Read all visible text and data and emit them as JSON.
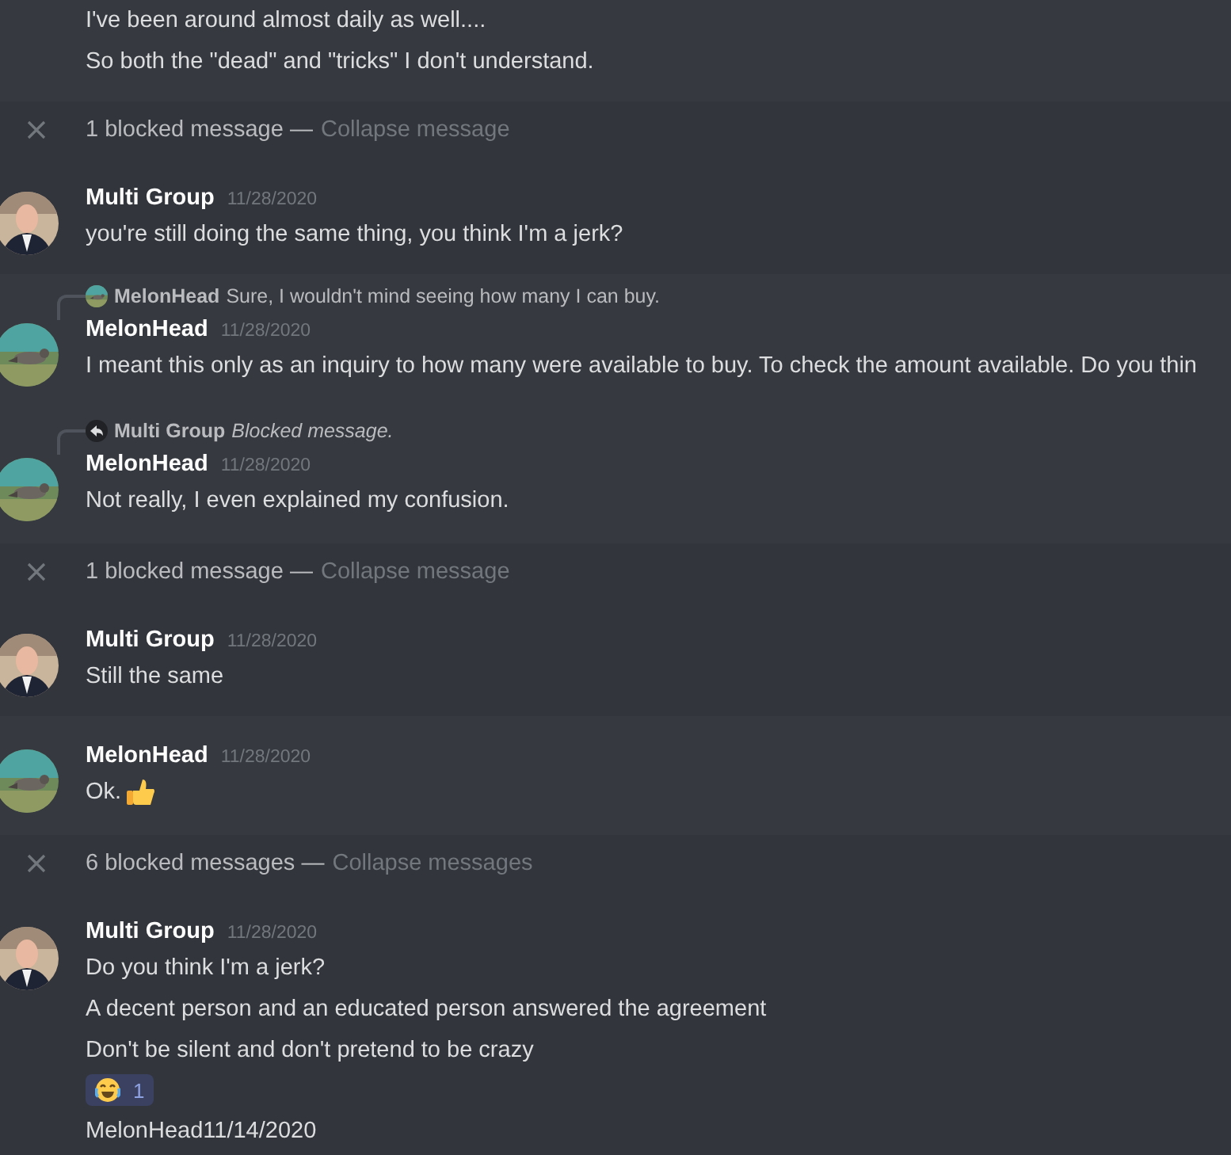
{
  "items": [
    {
      "kind": "continuation",
      "lines": [
        "I've been around almost daily as well....",
        "So both the \"dead\" and \"tricks\" I don't understand."
      ]
    },
    {
      "kind": "blocked",
      "summary": "1 blocked message —",
      "action": "Collapse message",
      "messages": [
        {
          "author": "Multi Group",
          "avatar": {
            "kind": "person"
          },
          "timestamp": "11/28/2020",
          "lines": [
            "you're still doing the same thing, you think I'm a jerk?"
          ]
        }
      ]
    },
    {
      "kind": "message",
      "author": "MelonHead",
      "avatar": {
        "kind": "bird"
      },
      "timestamp": "11/28/2020",
      "reply": {
        "author": "MelonHead",
        "avatar": {
          "kind": "bird"
        },
        "blocked": false,
        "text": "Sure, I wouldn't mind seeing how many I can buy."
      },
      "lines": [
        "I meant this only as an inquiry to how many were available to buy. To check the amount available. Do you thin"
      ]
    },
    {
      "kind": "message",
      "author": "MelonHead",
      "avatar": {
        "kind": "bird"
      },
      "timestamp": "11/28/2020",
      "reply": {
        "author": "Multi Group",
        "blocked": true,
        "text": "Blocked message."
      },
      "lines": [
        "Not really, I even explained my confusion."
      ]
    },
    {
      "kind": "blocked",
      "summary": "1 blocked message —",
      "action": "Collapse message",
      "messages": [
        {
          "author": "Multi Group",
          "avatar": {
            "kind": "person"
          },
          "timestamp": "11/28/2020",
          "lines": [
            "Still the same"
          ]
        }
      ]
    },
    {
      "kind": "message",
      "author": "MelonHead",
      "avatar": {
        "kind": "bird"
      },
      "timestamp": "11/28/2020",
      "lines": [
        "Ok."
      ],
      "emoji": {
        "kind": "thumbs-up"
      }
    },
    {
      "kind": "blocked",
      "summary": "6 blocked messages —",
      "action": "Collapse messages",
      "messages": [
        {
          "author": "Multi Group",
          "avatar": {
            "kind": "person"
          },
          "timestamp": "11/28/2020",
          "lines": [
            "Do you think I'm a jerk?",
            "A decent person and an educated person answered the agreement",
            "Don't be silent and don't pretend to be crazy"
          ],
          "reaction": {
            "count": "1"
          },
          "after": "MelonHead11/14/2020"
        }
      ]
    }
  ]
}
